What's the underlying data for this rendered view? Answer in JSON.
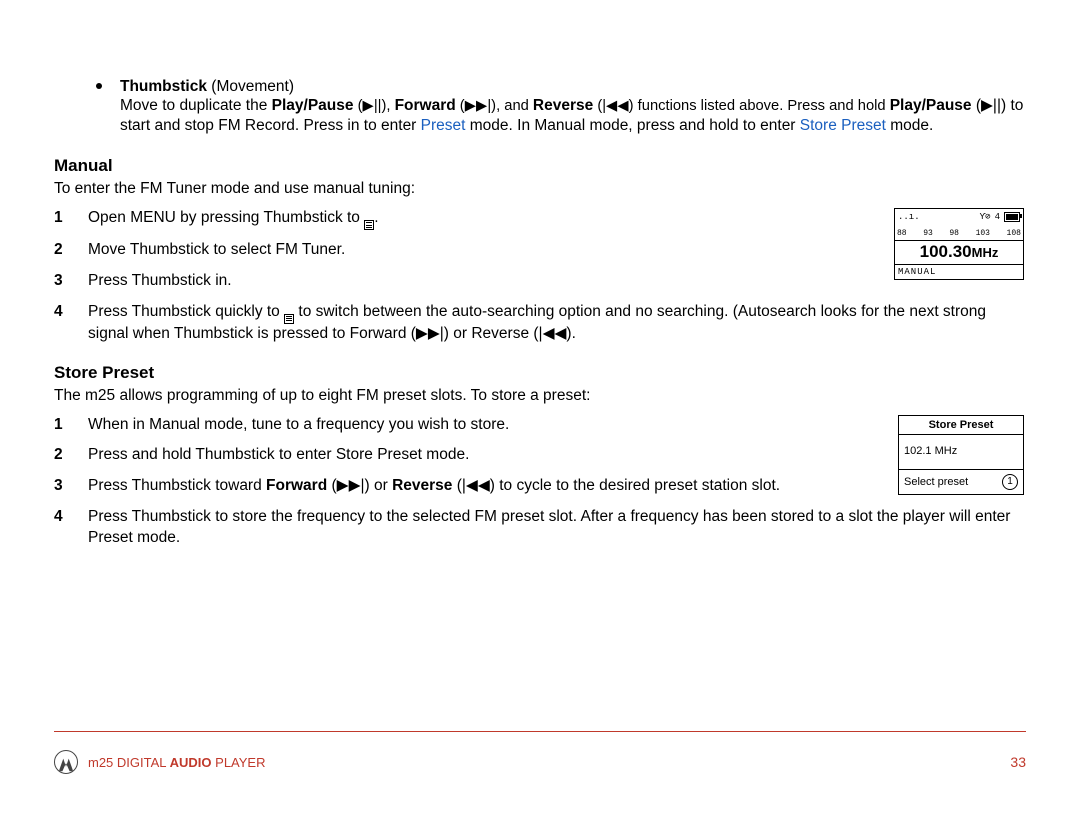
{
  "bullet": {
    "term_bold": "Thumbstick",
    "term_rest": " (Movement)",
    "desc_1": "Move to duplicate the ",
    "play_pause": "Play/Pause",
    "play_pause_sym": " (▶||), ",
    "forward": "Forward",
    "forward_sym": " (▶▶|), and ",
    "reverse": "Reverse",
    "reverse_sym": " (|◀◀) functions listed above. Press and hold ",
    "play_pause2": "Play/Pause",
    "desc_2": " (▶||) to start and stop FM Record. Press in to enter ",
    "preset_link": "Preset",
    "desc_3": " mode. In Manual mode, press and hold to enter ",
    "store_preset_link": "Store Preset",
    "desc_4": " mode."
  },
  "manual": {
    "heading": "Manual",
    "intro": "To enter the FM Tuner mode and use manual tuning:",
    "step1_a": "Open MENU by pressing Thumbstick to ",
    "step1_b": ".",
    "step2": "Move Thumbstick to select FM Tuner.",
    "step3": "Press Thumbstick in.",
    "step4_a": "Press Thumbstick quickly to ",
    "step4_b": " to switch between the auto-searching option and no searching. (Autosearch looks for the next strong signal when Thumbstick is pressed to Forward (▶▶|) or Reverse (|◀◀)."
  },
  "store": {
    "heading": "Store Preset",
    "intro": "The m25 allows programming of up to eight FM preset slots. To store a preset:",
    "step1": "When in Manual mode, tune to a frequency you wish to store.",
    "step2": "Press and hold Thumbstick to enter Store Preset mode.",
    "step3_a": "Press Thumbstick toward ",
    "step3_fwd": "Forward",
    "step3_b": " (▶▶|) or ",
    "step3_rev": "Reverse",
    "step3_c": " (|◀◀) to cycle to the desired preset station slot.",
    "step4": "Press Thumbstick to store the frequency to the selected FM preset slot. After a frequency has been stored to a slot the player will enter Preset mode."
  },
  "fig_fm": {
    "status_left": "..ı.",
    "status_antenna": "Ƴ⊘",
    "status_num": "4",
    "ticks": [
      "88",
      "93",
      "98",
      "103",
      "108"
    ],
    "freq": "100.30",
    "unit": "MHz",
    "mode": "MANUAL"
  },
  "fig_sp": {
    "title": "Store Preset",
    "freq": "102.1 MHz",
    "select_label": "Select preset",
    "select_num": "1"
  },
  "footer": {
    "brand_pre": "m25 DIGITAL ",
    "brand_bold": "AUDIO",
    "brand_post": " PLAYER",
    "page": "33"
  }
}
